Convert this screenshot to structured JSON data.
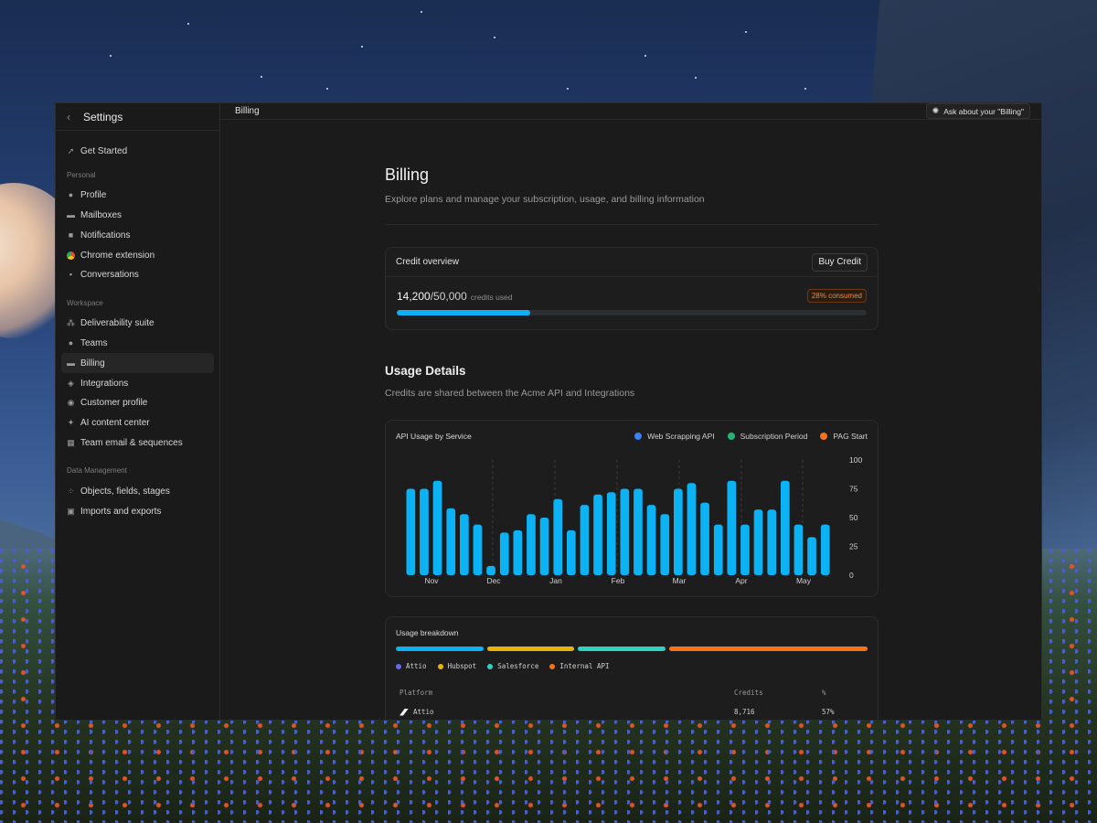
{
  "sidebar": {
    "title": "Settings",
    "top_item": {
      "label": "Get Started",
      "icon": "rocket-icon"
    },
    "sections": [
      {
        "title": "Personal",
        "items": [
          {
            "label": "Profile",
            "icon": "user-icon"
          },
          {
            "label": "Mailboxes",
            "icon": "mailbox-icon"
          },
          {
            "label": "Notifications",
            "icon": "bell-icon"
          },
          {
            "label": "Chrome extension",
            "icon": "chrome-icon"
          },
          {
            "label": "Conversations",
            "icon": "chat-icon"
          }
        ]
      },
      {
        "title": "Workspace",
        "items": [
          {
            "label": "Deliverability suite",
            "icon": "network-icon"
          },
          {
            "label": "Teams",
            "icon": "team-icon"
          },
          {
            "label": "Billing",
            "icon": "credit-card-icon",
            "active": true
          },
          {
            "label": "Integrations",
            "icon": "layers-icon"
          },
          {
            "label": "Customer profile",
            "icon": "customer-icon"
          },
          {
            "label": "AI content center",
            "icon": "sparkle-icon"
          },
          {
            "label": "Team email & sequences",
            "icon": "grid-icon"
          }
        ]
      },
      {
        "title": "Data Management",
        "items": [
          {
            "label": "Objects, fields, stages",
            "icon": "objects-icon"
          },
          {
            "label": "Imports and exports",
            "icon": "import-export-icon"
          }
        ]
      }
    ]
  },
  "topbar": {
    "breadcrumb": "Billing",
    "ask_button": "Ask about your \"Billing\""
  },
  "page": {
    "title": "Billing",
    "subtitle": "Explore plans and manage your subscription, usage, and billing information"
  },
  "credit": {
    "title": "Credit overview",
    "buy_button": "Buy Credit",
    "used": "14,200",
    "total": "/50,000",
    "used_label": "credits used",
    "badge": "28% consumed",
    "progress": 0.284,
    "progress_color": "#0fb0f3"
  },
  "usage": {
    "title": "Usage Details",
    "subtitle": "Credits are shared between the Acme API and Integrations"
  },
  "chart_data": {
    "type": "bar",
    "title": "API Usage by Service",
    "legend": [
      {
        "label": "Web Scrapping API",
        "color": "#3b82f6"
      },
      {
        "label": "Subscription Period",
        "color": "#22b573"
      },
      {
        "label": "PAG Start",
        "color": "#f97316"
      }
    ],
    "legend_position": "top-right",
    "x_tick_labels": [
      "Nov",
      "Dec",
      "Jan",
      "Feb",
      "Mar",
      "Apr",
      "May"
    ],
    "y_ticks": [
      100,
      75,
      50,
      25,
      0
    ],
    "ylim": [
      0,
      100
    ],
    "y_axis_side": "right",
    "grid": "dashed vertical",
    "bar_color": "#0bb2f4",
    "values": [
      75,
      75,
      82,
      58,
      53,
      44,
      8,
      37,
      39,
      53,
      50,
      66,
      39,
      61,
      70,
      72,
      75,
      75,
      61,
      53,
      75,
      80,
      63,
      44,
      82,
      44,
      57,
      57,
      82,
      44,
      33,
      44
    ]
  },
  "breakdown": {
    "title": "Usage breakdown",
    "segments": [
      {
        "label": "Attio",
        "color": "#0bb2f4",
        "dot": "#6366f1",
        "share": 0.18
      },
      {
        "label": "Hubspot",
        "color": "#eab308",
        "dot": "#eab308",
        "share": 0.18
      },
      {
        "label": "Salesforce",
        "color": "#2dd4bf",
        "dot": "#2dd4bf",
        "share": 0.18
      },
      {
        "label": "Internal API",
        "color": "#f97316",
        "dot": "#f97316",
        "share": 0.41
      }
    ],
    "columns": [
      "Platform",
      "Credits",
      "%"
    ],
    "rows": [
      {
        "platform": "Attio",
        "credits": "8,716",
        "percent": "57%"
      }
    ]
  }
}
